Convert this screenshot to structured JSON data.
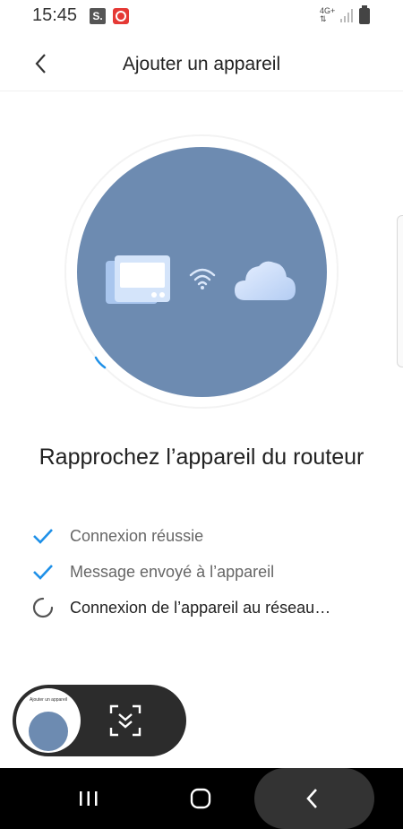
{
  "status_bar": {
    "time": "15:45",
    "notification_s": "S.",
    "network": "4G+"
  },
  "header": {
    "title": "Ajouter un appareil"
  },
  "illustration": {
    "circle_color": "#6d8bb1",
    "icons": [
      "device-icon",
      "wifi-icon",
      "cloud-icon"
    ]
  },
  "main": {
    "title": "Rapprochez l’appareil du routeur"
  },
  "steps": [
    {
      "label": "Connexion réussie",
      "state": "done"
    },
    {
      "label": "Message envoyé à l’appareil",
      "state": "done"
    },
    {
      "label": "Connexion de l’appareil au réseau…",
      "state": "in-progress"
    }
  ],
  "floating": {
    "thumbnail_title": "Ajouter un appareil"
  },
  "colors": {
    "accent": "#1e90e8",
    "nav_bg": "#000000"
  }
}
